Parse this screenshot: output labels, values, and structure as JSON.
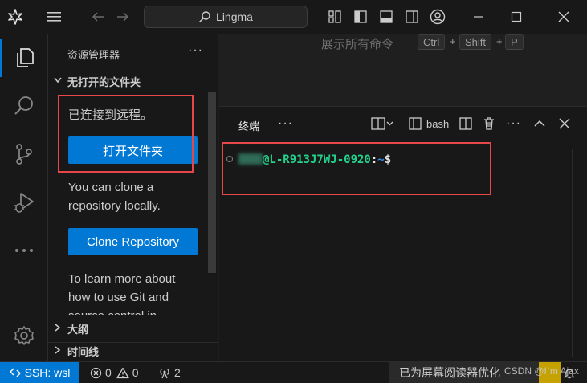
{
  "titlebar": {
    "search_text": "Lingma",
    "icons": [
      "vscode-logo-icon",
      "menu-icon",
      "back-arrow-icon",
      "forward-arrow-icon",
      "customize-layout-icon",
      "toggle-primary-sidebar-icon",
      "toggle-panel-icon",
      "toggle-secondary-sidebar-icon",
      "account-icon",
      "minimize-icon",
      "maximize-icon",
      "close-icon"
    ]
  },
  "activity": {
    "items": [
      "explorer-icon",
      "search-icon",
      "source-control-icon",
      "run-debug-icon",
      "more-icon",
      "settings-gear-icon"
    ]
  },
  "sidebar": {
    "title": "资源管理器",
    "more": "···",
    "section_no_folder": "无打开的文件夹",
    "connected_text": "已连接到远程。",
    "open_folder_button": "打开文件夹",
    "clone_text": "You can clone a repository locally.",
    "clone_button": "Clone Repository",
    "learn_text": "To learn more about how to use Git and source control in",
    "outline_section": "大纲",
    "timeline_section": "时间线"
  },
  "editor": {
    "hint": "展示所有命令",
    "keys": [
      "Ctrl",
      "Shift",
      "P"
    ],
    "plus": "+"
  },
  "panel": {
    "tab_terminal": "终端",
    "more": "···",
    "shell_label": "bash",
    "prompt_host": "@L-R913J7WJ-0920",
    "prompt_colon": ":",
    "prompt_path": "~",
    "prompt_symbol": "$"
  },
  "statusbar": {
    "remote": "SSH: wsl",
    "errors": "0",
    "warnings": "0",
    "ports": "2",
    "reader": "已为屏幕阅读器优化",
    "watermark": "CSDN @I`m Ajax"
  },
  "colors": {
    "accent": "#0078d4",
    "highlight_box": "#e8474a",
    "prompt_green": "#23d18b",
    "prompt_blue": "#3b8eea"
  }
}
